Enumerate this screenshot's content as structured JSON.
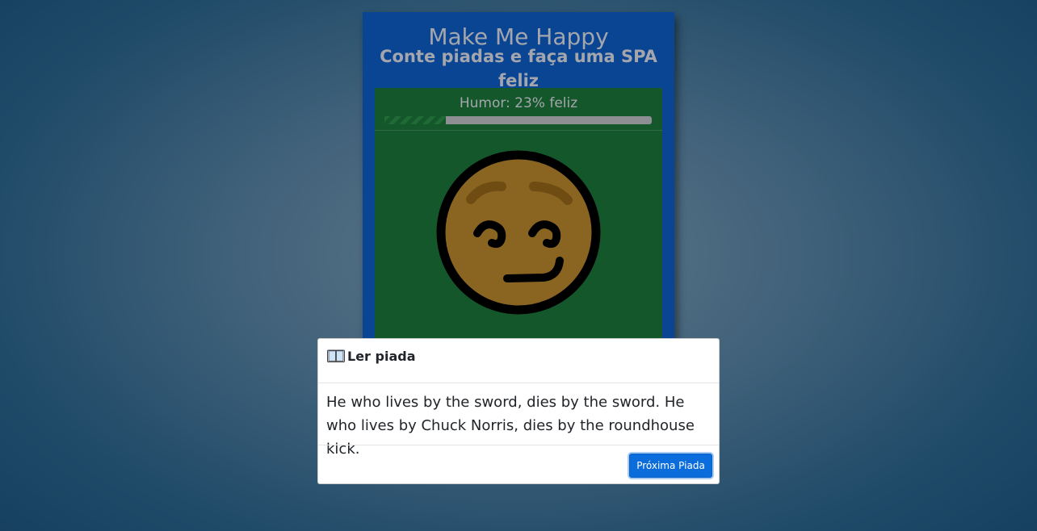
{
  "app": {
    "title": "Make Me Happy",
    "subtitle": "Conte piadas e faça uma SPA feliz"
  },
  "mood": {
    "label": "Humor: 23% feliz",
    "percent": 23,
    "face_icon": "smirking-face-icon"
  },
  "modal": {
    "icon": "open-book-icon",
    "title": "Ler piada",
    "joke": "He who lives by the sword, dies by the sword. He who lives by Chuck Norris, dies by the roundhouse kick.",
    "next_button_label": "Próxima Piada"
  },
  "colors": {
    "card": "#0a4594",
    "panel": "#14572a",
    "button": "#0b6ddb"
  }
}
